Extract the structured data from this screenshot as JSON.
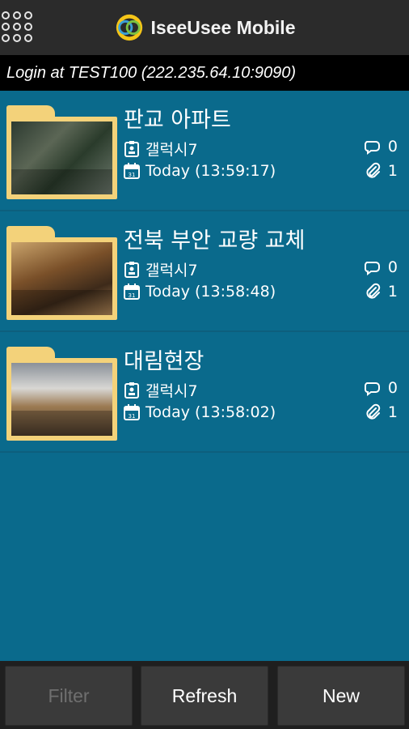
{
  "header": {
    "app_title": "IseeUsee Mobile",
    "menu_icon": "grid-menu-icon",
    "logo_icon": "app-logo-icon"
  },
  "login_bar": {
    "text": "Login at TEST100 (222.235.64.10:9090)"
  },
  "items": [
    {
      "title": "판교 아파트",
      "author": "갤럭시7",
      "date": "Today (13:59:17)",
      "comments": "0",
      "attachments": "1"
    },
    {
      "title": "전북 부안 교량 교체",
      "author": "갤럭시7",
      "date": "Today (13:58:48)",
      "comments": "0",
      "attachments": "1"
    },
    {
      "title": "대림현장",
      "author": "갤럭시7",
      "date": "Today (13:58:02)",
      "comments": "0",
      "attachments": "1"
    }
  ],
  "toolbar": {
    "filter_label": "Filter",
    "refresh_label": "Refresh",
    "new_label": "New"
  },
  "colors": {
    "background": "#0a6a8c",
    "header": "#2b2b2b",
    "folder": "#f3d27a",
    "button": "#3a3a3a",
    "disabled_text": "#6f6f6f"
  }
}
